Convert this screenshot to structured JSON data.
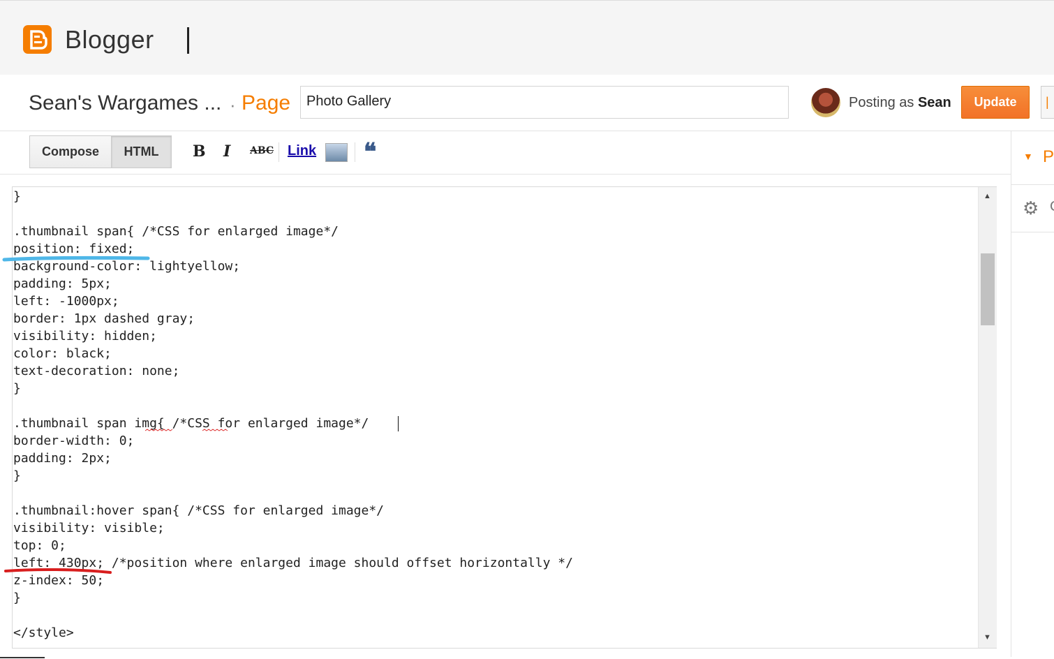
{
  "header": {
    "brand": "Blogger",
    "logo_letter": "B",
    "colors": {
      "brand_orange": "#f57d00"
    }
  },
  "titlebar": {
    "blog_title": "Sean's Wargames ...",
    "separator": "·",
    "page_label": "Page",
    "post_title_value": "Photo Gallery",
    "posting_as_prefix": "Posting as",
    "posting_as_name": "Sean",
    "update_label": "Update"
  },
  "toolbar": {
    "compose_label": "Compose",
    "html_label": "HTML",
    "bold_icon": "B",
    "italic_icon": "I",
    "strike_icon": "ABC",
    "link_label": "Link",
    "quote_icon": "❝"
  },
  "sidebar": {
    "first_item_letter": "P",
    "second_item_letter": "C"
  },
  "editor": {
    "lines": [
      "}",
      "",
      ".thumbnail span{ /*CSS for enlarged image*/",
      "position: fixed;",
      "background-color: lightyellow;",
      "padding: 5px;",
      "left: -1000px;",
      "border: 1px dashed gray;",
      "visibility: hidden;",
      "color: black;",
      "text-decoration: none;",
      "}",
      "",
      ".thumbnail span img{ /*CSS for enlarged image*/",
      "border-width: 0;",
      "padding: 2px;",
      "}",
      "",
      ".thumbnail:hover span{ /*CSS for enlarged image*/",
      "visibility: visible;",
      "top: 0;",
      "left: 430px; /*position where enlarged image should offset horizontally */",
      "z-index: 50;",
      "}",
      "",
      "</style>"
    ]
  },
  "annotations": {
    "blue_underline_color": "#4fb7e8",
    "red_underline_color": "#d81e1e"
  }
}
